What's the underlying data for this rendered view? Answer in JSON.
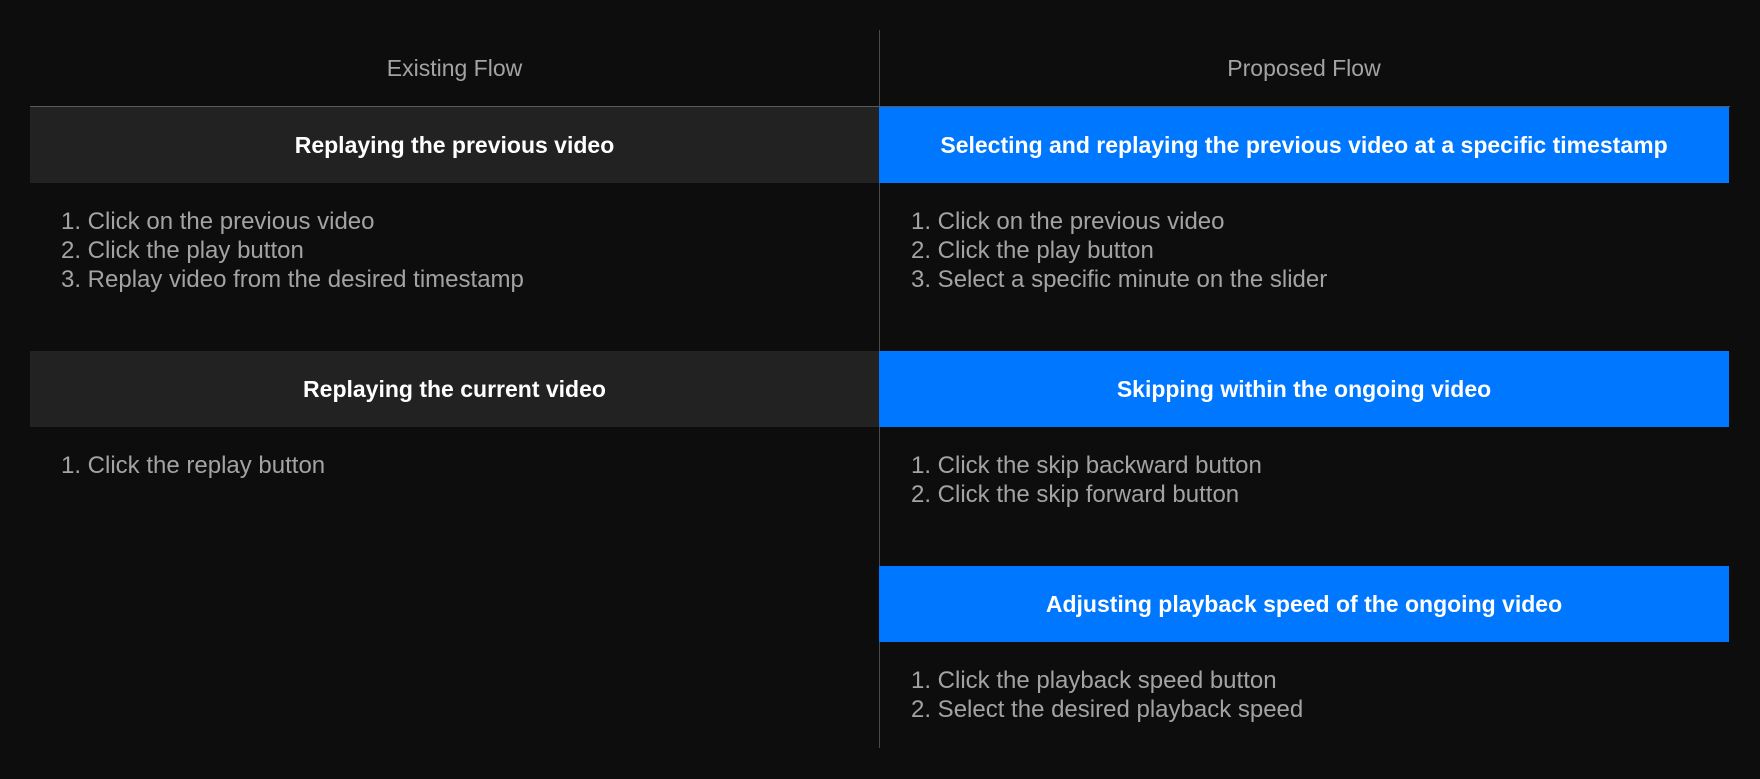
{
  "columns": {
    "existing": {
      "title": "Existing Flow",
      "sections": [
        {
          "heading": "Replaying the previous video",
          "steps": [
            "1. Click on the previous video",
            "2. Click the play button",
            "3. Replay video from the desired timestamp"
          ]
        },
        {
          "heading": "Replaying the current video",
          "steps": [
            "1. Click the replay button"
          ]
        }
      ]
    },
    "proposed": {
      "title": "Proposed Flow",
      "sections": [
        {
          "heading": "Selecting and replaying the previous video at a specific timestamp",
          "steps": [
            "1. Click on the previous video",
            "2. Click the play button",
            "3. Select a specific minute on the slider"
          ]
        },
        {
          "heading": "Skipping within the ongoing video",
          "steps": [
            "1. Click the skip backward button",
            "2. Click the skip forward button"
          ]
        },
        {
          "heading": "Adjusting playback speed of the ongoing video",
          "steps": [
            "1. Click the playback speed button",
            "2. Select the desired playback speed"
          ]
        }
      ]
    }
  },
  "colors": {
    "background": "#0d0d0d",
    "existing_banner": "#222222",
    "proposed_banner": "#0077ff",
    "muted_text": "#a3a3a3"
  }
}
